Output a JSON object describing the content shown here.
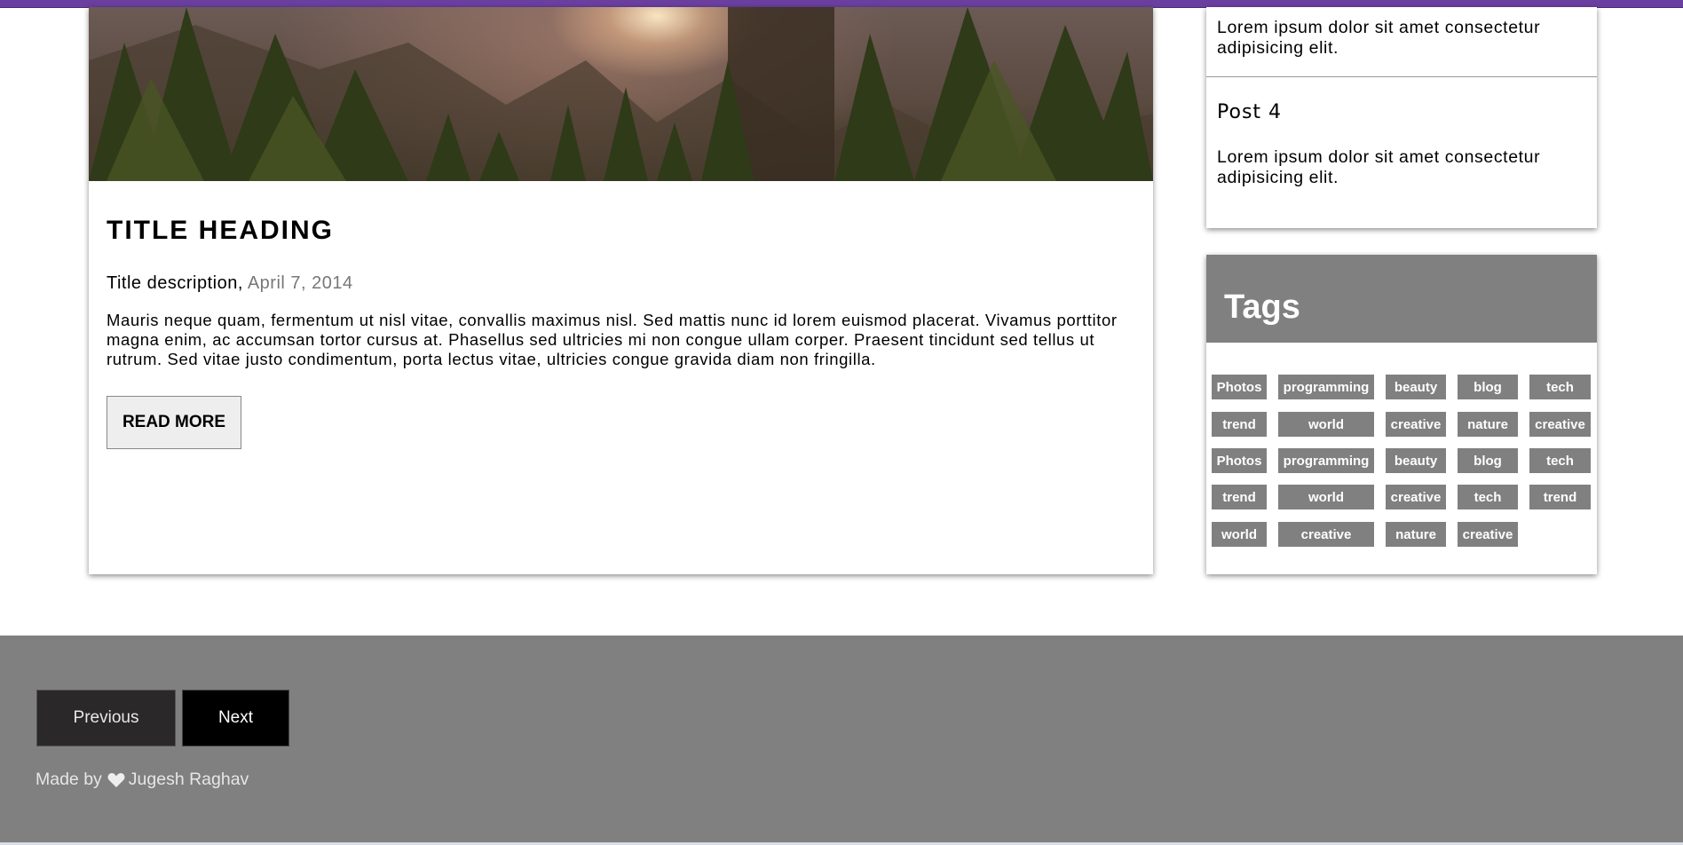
{
  "post": {
    "title": "TITLE HEADING",
    "description": "Title description,",
    "date": "April 7, 2014",
    "body": "Mauris neque quam, fermentum ut nisl vitae, convallis maximus nisl. Sed mattis nunc id lorem euismod placerat. Vivamus porttitor magna enim, ac accumsan tortor cursus at. Phasellus sed ultricies mi non congue ullam corper. Praesent tincidunt sed tellus ut rutrum. Sed vitae justo condimentum, porta lectus vitae, ultricies congue gravida diam non fringilla.",
    "read_more_label": "READ MORE"
  },
  "sidebar_posts": {
    "excerpt_top": "Lorem ipsum dolor sit amet consectetur adipisicing elit.",
    "post4_title": "Post 4",
    "post4_excerpt": "Lorem ipsum dolor sit amet consectetur adipisicing elit."
  },
  "tags": {
    "title": "Tags",
    "items": [
      "Photos",
      "programming",
      "beauty",
      "blog",
      "tech",
      "trend",
      "world",
      "creative",
      "nature",
      "creative",
      "Photos",
      "programming",
      "beauty",
      "blog",
      "tech",
      "trend",
      "world",
      "creative",
      "tech",
      "trend",
      "world",
      "creative",
      "nature",
      "creative"
    ]
  },
  "pagination": {
    "previous_label": "Previous",
    "next_label": "Next"
  },
  "footer": {
    "made_by": "Made by",
    "author": "Jugesh Raghav"
  },
  "colors": {
    "accent_bar": "#6a3fa0",
    "tag_bg": "#808080",
    "footer_bg": "#808080"
  }
}
